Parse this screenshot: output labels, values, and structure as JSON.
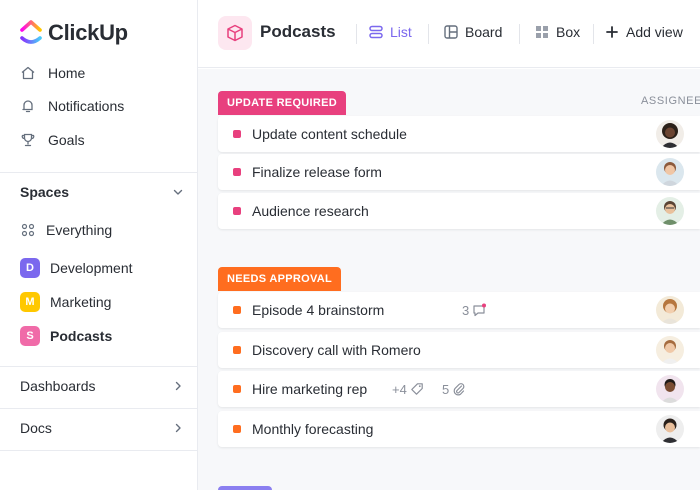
{
  "app": {
    "logo_text": "ClickUp"
  },
  "sidebar": {
    "nav": [
      {
        "label": "Home",
        "icon": "home-icon"
      },
      {
        "label": "Notifications",
        "icon": "bell-icon"
      },
      {
        "label": "Goals",
        "icon": "trophy-icon"
      }
    ],
    "spaces_label": "Spaces",
    "spaces": [
      {
        "label": "Everything",
        "icon": "grid-dots-icon"
      },
      {
        "label": "Development",
        "badge": "D",
        "color": "#7b68ee"
      },
      {
        "label": "Marketing",
        "badge": "M",
        "color": "#ffc800"
      },
      {
        "label": "Podcasts",
        "badge": "S",
        "color": "#f06ba8"
      }
    ],
    "sections": [
      {
        "label": "Dashboards"
      },
      {
        "label": "Docs"
      }
    ]
  },
  "header": {
    "title": "Podcasts",
    "views": [
      {
        "label": "List",
        "icon": "list-icon",
        "active": true
      },
      {
        "label": "Board",
        "icon": "board-icon"
      },
      {
        "label": "Box",
        "icon": "box-icon"
      },
      {
        "label": "Add view",
        "icon": "plus-icon"
      }
    ]
  },
  "main": {
    "assignee_header": "ASSIGNEE",
    "groups": [
      {
        "label": "UPDATE REQUIRED",
        "color": "#e8407e",
        "tasks": [
          {
            "name": "Update content schedule"
          },
          {
            "name": "Finalize release form"
          },
          {
            "name": "Audience research"
          }
        ]
      },
      {
        "label": "NEEDS APPROVAL",
        "color": "#ff6d1f",
        "tasks": [
          {
            "name": "Episode 4 brainstorm",
            "comments": "3"
          },
          {
            "name": "Discovery call with Romero"
          },
          {
            "name": "Hire marketing rep",
            "tags": "+4",
            "attachments": "5"
          },
          {
            "name": "Monthly forecasting"
          }
        ]
      }
    ]
  }
}
